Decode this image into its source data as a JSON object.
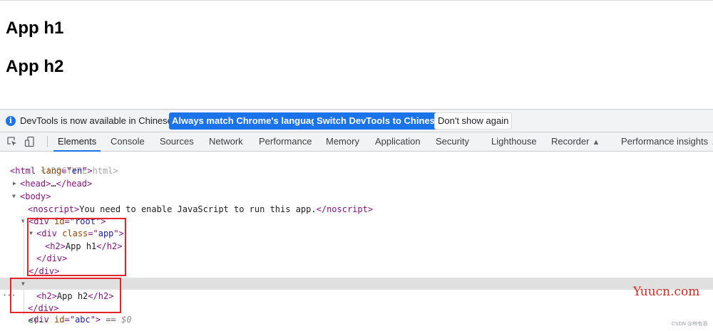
{
  "page": {
    "heading1": "App h1",
    "heading2": "App h2"
  },
  "infobar": {
    "icon": "info-icon",
    "message": "DevTools is now available in Chinese!",
    "match_language_label": "Always match Chrome's language",
    "switch_label": "Switch DevTools to Chinese",
    "dont_show_label": "Don't show again"
  },
  "tabbar": {
    "tabs": [
      "Elements",
      "Console",
      "Sources",
      "Network",
      "Performance",
      "Memory",
      "Application",
      "Security",
      "Lighthouse",
      "Recorder",
      "Performance insights"
    ],
    "active_tab": "Elements",
    "experimental_icon": "flask-icon"
  },
  "dom_tree": {
    "doctype": "<!DOCTYPE html>",
    "html_tag": "html",
    "lang_attr": "lang",
    "lang_value": "en",
    "head_tag": "head",
    "ellipsis": "…",
    "body_tag": "body",
    "noscript_tag": "noscript",
    "noscript_text": "You need to enable JavaScript to run this app.",
    "div_tag": "div",
    "id_attr": "id",
    "root_value": "root",
    "class_attr": "class",
    "app_value": "app",
    "h2_tag": "h2",
    "h2_text_1": "App h1",
    "abc_value": "abc",
    "h2_text_2": "App h2",
    "selected_marker": "==",
    "selected_var": "$0",
    "comment_open": "<!--"
  },
  "watermark": "Yuucn.com",
  "credit": "CSDN @林有酒",
  "colors": {
    "accent": "#1a73e8",
    "highlight_box": "#e0262b",
    "tag": "#881280",
    "attr_name": "#994500",
    "attr_value": "#1a1aa6"
  }
}
